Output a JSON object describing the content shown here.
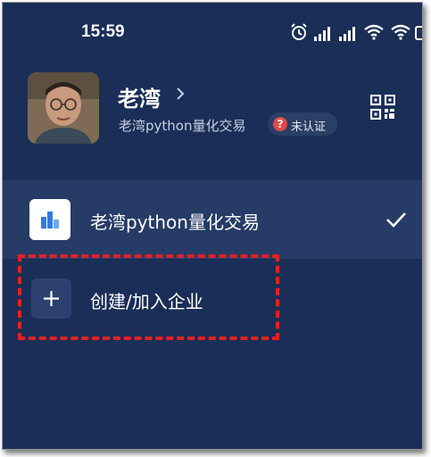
{
  "status_bar": {
    "time": "15:59",
    "icons": [
      "alarm-icon",
      "signal-icon",
      "signal-icon",
      "wifi-icon",
      "wifi-icon",
      "battery-icon"
    ]
  },
  "profile": {
    "name": "老湾",
    "org": "老湾python量化交易",
    "verify_icon": "?",
    "verify_status": "未认证"
  },
  "org_list": {
    "items": [
      {
        "label": "老湾python量化交易",
        "selected": true
      },
      {
        "label": "创建/加入企业",
        "selected": false
      }
    ]
  },
  "colors": {
    "background": "#1a2e57",
    "selected_row": "#263c66",
    "highlight": "#e52020",
    "badge_alert": "#e24a4a"
  }
}
